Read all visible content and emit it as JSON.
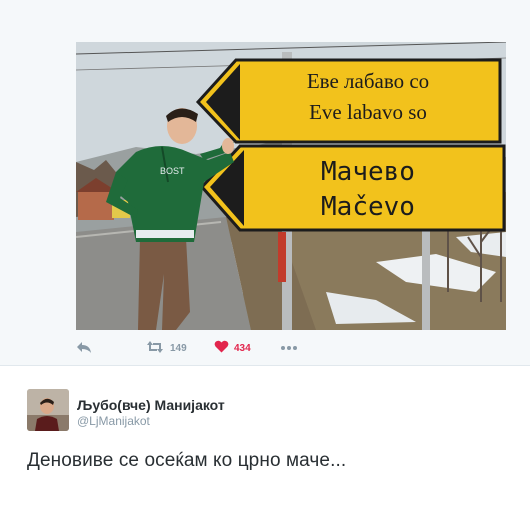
{
  "photo": {
    "sign_top": {
      "line1": "Еве лабаво со",
      "line2": "Eve labavo so"
    },
    "sign_bottom": {
      "line1": "Мачево",
      "line2": "Mačevo"
    },
    "shirt_text": "BOST"
  },
  "actions": {
    "reply_icon": "reply-icon",
    "retweet_icon": "retweet-icon",
    "retweet_count": "149",
    "like_icon": "heart-icon",
    "like_count": "434",
    "like_color": "#e2264d",
    "more_icon": "more-icon"
  },
  "author": {
    "display_name": "Љубо(вче) Манијакот",
    "handle": "@LjManijakot"
  },
  "tweet": {
    "text": "Деновиве се осеќам ко црно маче..."
  }
}
